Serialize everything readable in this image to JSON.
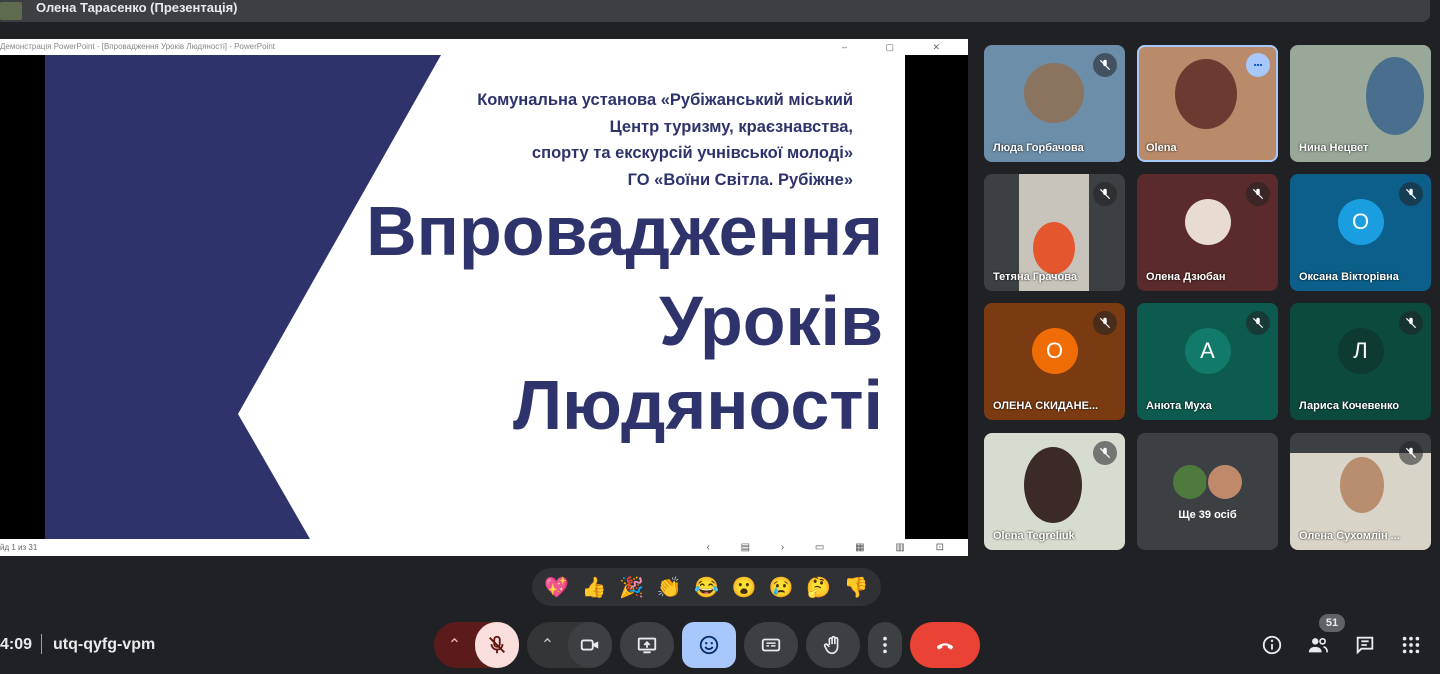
{
  "meeting": {
    "presenter_title": "Олена Тарасенко (Презентація)",
    "time": "4:09",
    "code": "utq-qyfg-vpm",
    "participant_count": "51"
  },
  "ppt": {
    "window_title": "Демонстрація PowerPoint - [Впровадження Уроків Людяності] - PowerPoint",
    "status": "йд 1 из 31"
  },
  "slide": {
    "org_lines": [
      "Комунальна установа «Рубіжанський міський",
      "Центр туризму, краєзнавства,",
      "спорту та екскурсій учнівської молоді»",
      "ГО «Воїни Світла. Рубіжне»"
    ],
    "title_lines": [
      "Впровадження",
      "Уроків",
      "Людяності"
    ],
    "accent_color": "#2e336b"
  },
  "participants": [
    {
      "name": "Люда Горбачова",
      "muted": true
    },
    {
      "name": "Olena",
      "speaking": true
    },
    {
      "name": "Нина Нецвет",
      "muted": false
    },
    {
      "name": "Тетяна Грачова",
      "muted": true
    },
    {
      "name": "Олена Дзюбан",
      "muted": true
    },
    {
      "name": "Оксана Вікторівна",
      "initial": "О",
      "muted": true
    },
    {
      "name": "ОЛЕНА СКИДАНЕ...",
      "initial": "О",
      "muted": true
    },
    {
      "name": "Анюта Муха",
      "initial": "А",
      "muted": true
    },
    {
      "name": "Лариса Кочевенко",
      "initial": "Л",
      "muted": true
    },
    {
      "name": "Olena Tegreliuk",
      "muted": true
    },
    {
      "name": "Ще 39 осіб"
    },
    {
      "name": "Олена Сухомлін ...",
      "muted": true
    }
  ],
  "reactions": [
    "💖",
    "👍",
    "🎉",
    "👏",
    "😂",
    "😮",
    "😢",
    "🤔",
    "👎"
  ],
  "icons": {
    "mic": "mic-off-icon",
    "camera": "camera-icon",
    "present": "present-screen-icon",
    "emoji": "emoji-icon",
    "captions": "captions-icon",
    "hand": "raise-hand-icon",
    "more": "more-options-icon",
    "end": "end-call-icon",
    "info": "info-icon",
    "people": "people-icon",
    "chat": "chat-icon",
    "activities": "activities-icon"
  },
  "colors": {
    "background": "#202124",
    "end_call": "#ea4335",
    "mic_off_bg": "#f9dedc",
    "emoji_active": "#a8c7fa"
  }
}
